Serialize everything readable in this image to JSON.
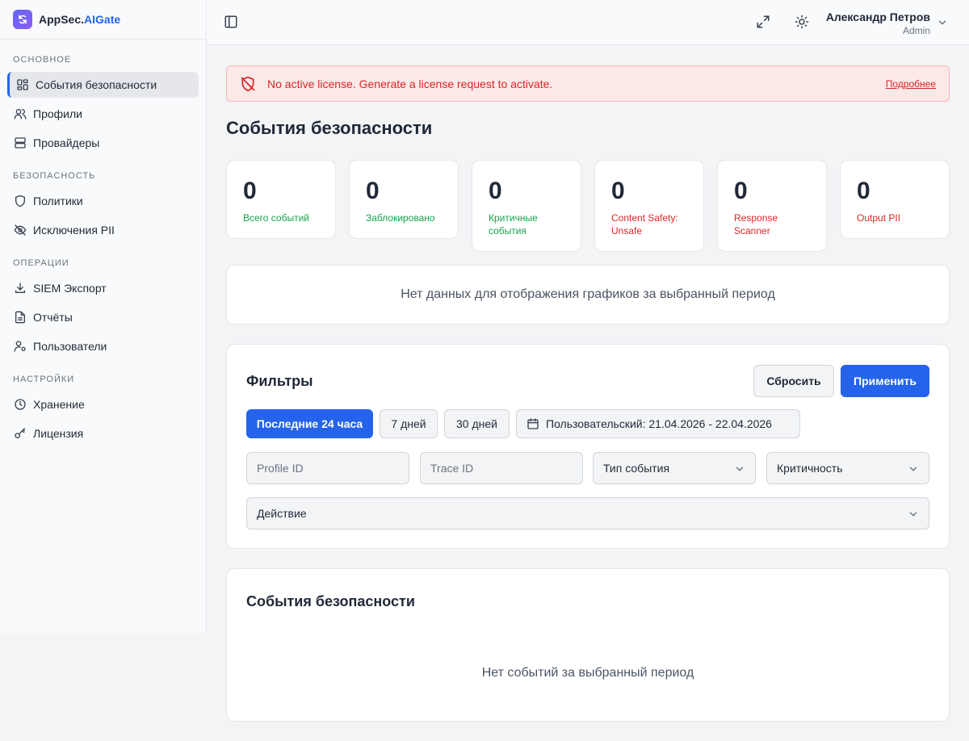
{
  "brand": {
    "name_main": "AppSec.",
    "name_accent": "AIGate"
  },
  "sidebar": {
    "sections": [
      {
        "title": "ОСНОВНОЕ",
        "items": [
          {
            "label": "События безопасности",
            "icon": "dashboard-icon",
            "active": true
          },
          {
            "label": "Профили",
            "icon": "users-icon"
          },
          {
            "label": "Провайдеры",
            "icon": "server-icon"
          }
        ]
      },
      {
        "title": "БЕЗОПАСНОСТЬ",
        "items": [
          {
            "label": "Политики",
            "icon": "shield-icon"
          },
          {
            "label": "Исключения PII",
            "icon": "eye-off-icon"
          }
        ]
      },
      {
        "title": "ОПЕРАЦИИ",
        "items": [
          {
            "label": "SIEM Экспорт",
            "icon": "download-icon"
          },
          {
            "label": "Отчёты",
            "icon": "file-text-icon"
          },
          {
            "label": "Пользователи",
            "icon": "user-cog-icon"
          }
        ]
      },
      {
        "title": "НАСТРОЙКИ",
        "items": [
          {
            "label": "Хранение",
            "icon": "clock-icon"
          },
          {
            "label": "Лицензия",
            "icon": "key-icon"
          }
        ]
      }
    ]
  },
  "header": {
    "user_name": "Александр Петров",
    "user_role": "Admin"
  },
  "alert": {
    "text": "No active license. Generate a license request to activate.",
    "link": "Подробнее"
  },
  "page": {
    "title": "События безопасности"
  },
  "stats": [
    {
      "value": "0",
      "label": "Всего событий",
      "color": "#16a34a"
    },
    {
      "value": "0",
      "label": "Заблокировано",
      "color": "#16a34a"
    },
    {
      "value": "0",
      "label": "Критичные события",
      "color": "#16a34a"
    },
    {
      "value": "0",
      "label": "Content Safety: Unsafe",
      "color": "#dc2626"
    },
    {
      "value": "0",
      "label": "Response Scanner",
      "color": "#dc2626"
    },
    {
      "value": "0",
      "label": "Output PII",
      "color": "#dc2626"
    }
  ],
  "charts": {
    "empty_text": "Нет данных для отображения графиков за выбранный период"
  },
  "filters": {
    "title": "Фильтры",
    "reset_label": "Сбросить",
    "apply_label": "Применить",
    "periods": [
      {
        "label": "Последние 24 часа",
        "active": true
      },
      {
        "label": "7 дней"
      },
      {
        "label": "30 дней"
      },
      {
        "label": "Пользовательский: 21.04.2026 - 22.04.2026",
        "icon": "calendar-icon"
      }
    ],
    "profile_id_placeholder": "Profile ID",
    "trace_id_placeholder": "Trace ID",
    "event_type_value": "Тип события",
    "severity_value": "Критичность",
    "action_value": "Действие"
  },
  "events": {
    "title": "События безопасности",
    "empty_text": "Нет событий за выбранный период"
  },
  "colors": {
    "accent": "#2563eb",
    "danger": "#dc2626",
    "success": "#16a34a"
  }
}
